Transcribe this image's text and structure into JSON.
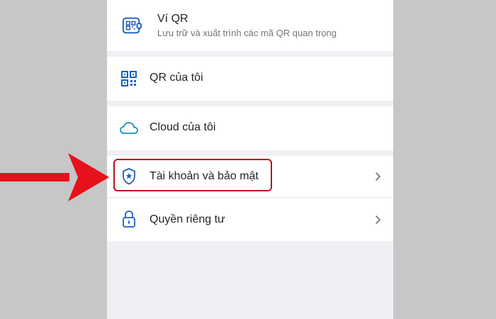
{
  "menu": {
    "qr_wallet": {
      "title": "Ví QR",
      "subtitle": "Lưu trữ và xuất trình các mã QR quan trọng",
      "icon": "wallet-qr-icon"
    },
    "my_qr": {
      "label": "QR của tôi",
      "icon": "qr-code-icon"
    },
    "cloud": {
      "label": "Cloud của tôi",
      "icon": "cloud-icon"
    },
    "account_security": {
      "label": "Tài khoản và bảo mật",
      "icon": "shield-icon"
    },
    "privacy": {
      "label": "Quyền riêng tư",
      "icon": "lock-icon"
    }
  },
  "colors": {
    "icon_blue": "#1b5fb8",
    "highlight_red": "#b3141b",
    "arrow_red": "#e6111b",
    "screen_background": "#eef0f3",
    "page_background": "#c7c7c7"
  }
}
